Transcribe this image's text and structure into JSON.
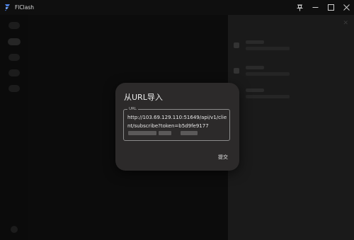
{
  "app": {
    "title": "FlClash",
    "icon": "flclash-logo-icon"
  },
  "window_controls": {
    "pin": "pin-icon",
    "minimize": "minimize-icon",
    "maximize": "maximize-icon",
    "close": "close-icon"
  },
  "dialog": {
    "title": "从URL导入",
    "field_label": "URL",
    "url_value": "http://103.69.129.110:51649/api/v1/client/subscribe?token=b5d9fe9177",
    "submit_label": "提交"
  },
  "colors": {
    "background": "#0e0e0e",
    "dialog_bg": "#2c2a2a",
    "accent": "#4a7fe0"
  }
}
